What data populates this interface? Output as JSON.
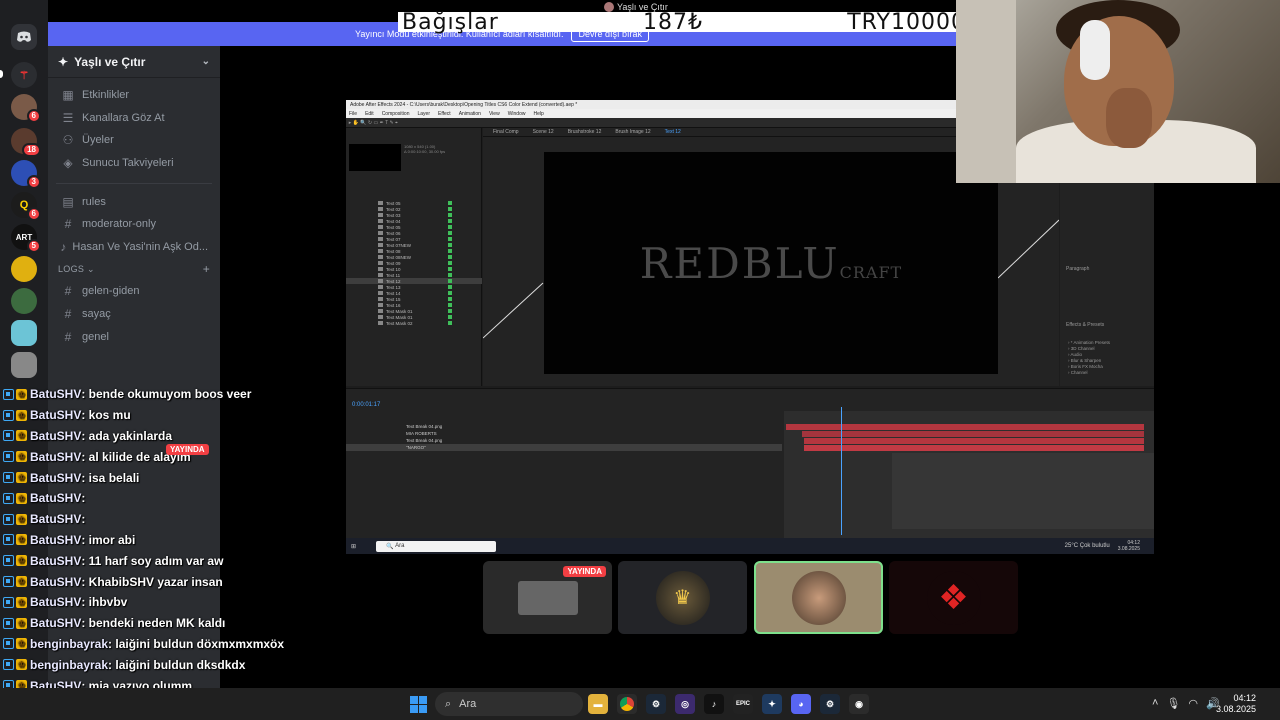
{
  "donation": {
    "label": "Bağışlar",
    "amount": "187₺",
    "goal": "TRY10000"
  },
  "stream_top_title": "Yaşlı ve Çıtır",
  "notice": {
    "text": "Yayıncı Modu etkinleştirildi. Kullanıcı adları kısaltıldı.",
    "button": "Devre dışı bırak"
  },
  "server": {
    "name": "Yaşlı ve Çıtır",
    "nav": [
      "Etkinlikler",
      "Kanallara Göz At",
      "Üyeler",
      "Sunucu Takviyeleri"
    ],
    "channels": [
      "rules",
      "moderator-only",
      "Hasan Ve Yasi'nin Aşk Od..."
    ],
    "category_logs": "LOGS",
    "log_channels": [
      "gelen-giden",
      "sayaç",
      "genel"
    ]
  },
  "rail_badges": [
    "6",
    "18",
    "3",
    "6",
    "5"
  ],
  "after_effects": {
    "title": "Adobe After Effects 2024 - C:\\Users\\burak\\Desktop\\Opening Titles CS6 Color Extend (converted).aep *",
    "menu": [
      "File",
      "Edit",
      "Composition",
      "Layer",
      "Effect",
      "Animation",
      "View",
      "Window",
      "Help"
    ],
    "comp_tabs": [
      "Final Comp",
      "Scene 12",
      "Brushstroke 12",
      "Brush Image 12",
      "Text 12"
    ],
    "project_items": [
      "Text 05",
      "Text 02",
      "Text 03",
      "Text 04",
      "Text 05",
      "Text 06",
      "Text 07",
      "Text 07NEW",
      "Text 08",
      "Text 08NEW",
      "Text 09",
      "Text 10",
      "Text 11",
      "Text 12",
      "Text 13",
      "Text 14",
      "Text 15",
      "Text 16",
      "Text Mask 01",
      "Text Mask 01",
      "Text Mask 02"
    ],
    "comp_text": "REDBLU",
    "comp_text_small": "CRAFT",
    "timecode": "0:00:01:17",
    "layers": [
      "Text Break 04.png",
      "MIA ROBERTS",
      "Text Break 04.png",
      "\"NARGO\""
    ],
    "search_label": "Ara",
    "clock_time": "04:12",
    "clock_date": "3.08.2025",
    "weather": "25°C Çok bulutlu"
  },
  "chat": [
    {
      "user": "BatuSHV",
      "text": ": bende okumuyom boos veer"
    },
    {
      "user": "BatuSHV",
      "text": ": kos mu"
    },
    {
      "user": "BatuSHV",
      "text": ": ada yakinlarda"
    },
    {
      "user": "BatuSHV",
      "text": ": al kilide de alayim"
    },
    {
      "user": "BatuSHV",
      "text": ": isa belali"
    },
    {
      "user": "BatuSHV",
      "text": ":"
    },
    {
      "user": "BatuSHV",
      "text": ":"
    },
    {
      "user": "BatuSHV",
      "text": ": imor abi"
    },
    {
      "user": "BatuSHV",
      "text": ": 11 harf soy adım var aw"
    },
    {
      "user": "BatuSHV",
      "text": ": KhabibSHV yazar insan"
    },
    {
      "user": "BatuSHV",
      "text": ": ihbvbv"
    },
    {
      "user": "BatuSHV",
      "text": ": bendeki neden MK kaldı"
    },
    {
      "user": "benginbayrak",
      "text": ": laiğini buldun döxmxmxmxöx"
    },
    {
      "user": "benginbayrak",
      "text": ": laiğini buldun dksdkdx"
    },
    {
      "user": "BatuSHV",
      "text": ": mia yazıyo olumm"
    }
  ],
  "live_badge": "YAYINDA",
  "taskbar": {
    "search": "Ara",
    "time": "04:12",
    "date": "3.08.2025"
  }
}
